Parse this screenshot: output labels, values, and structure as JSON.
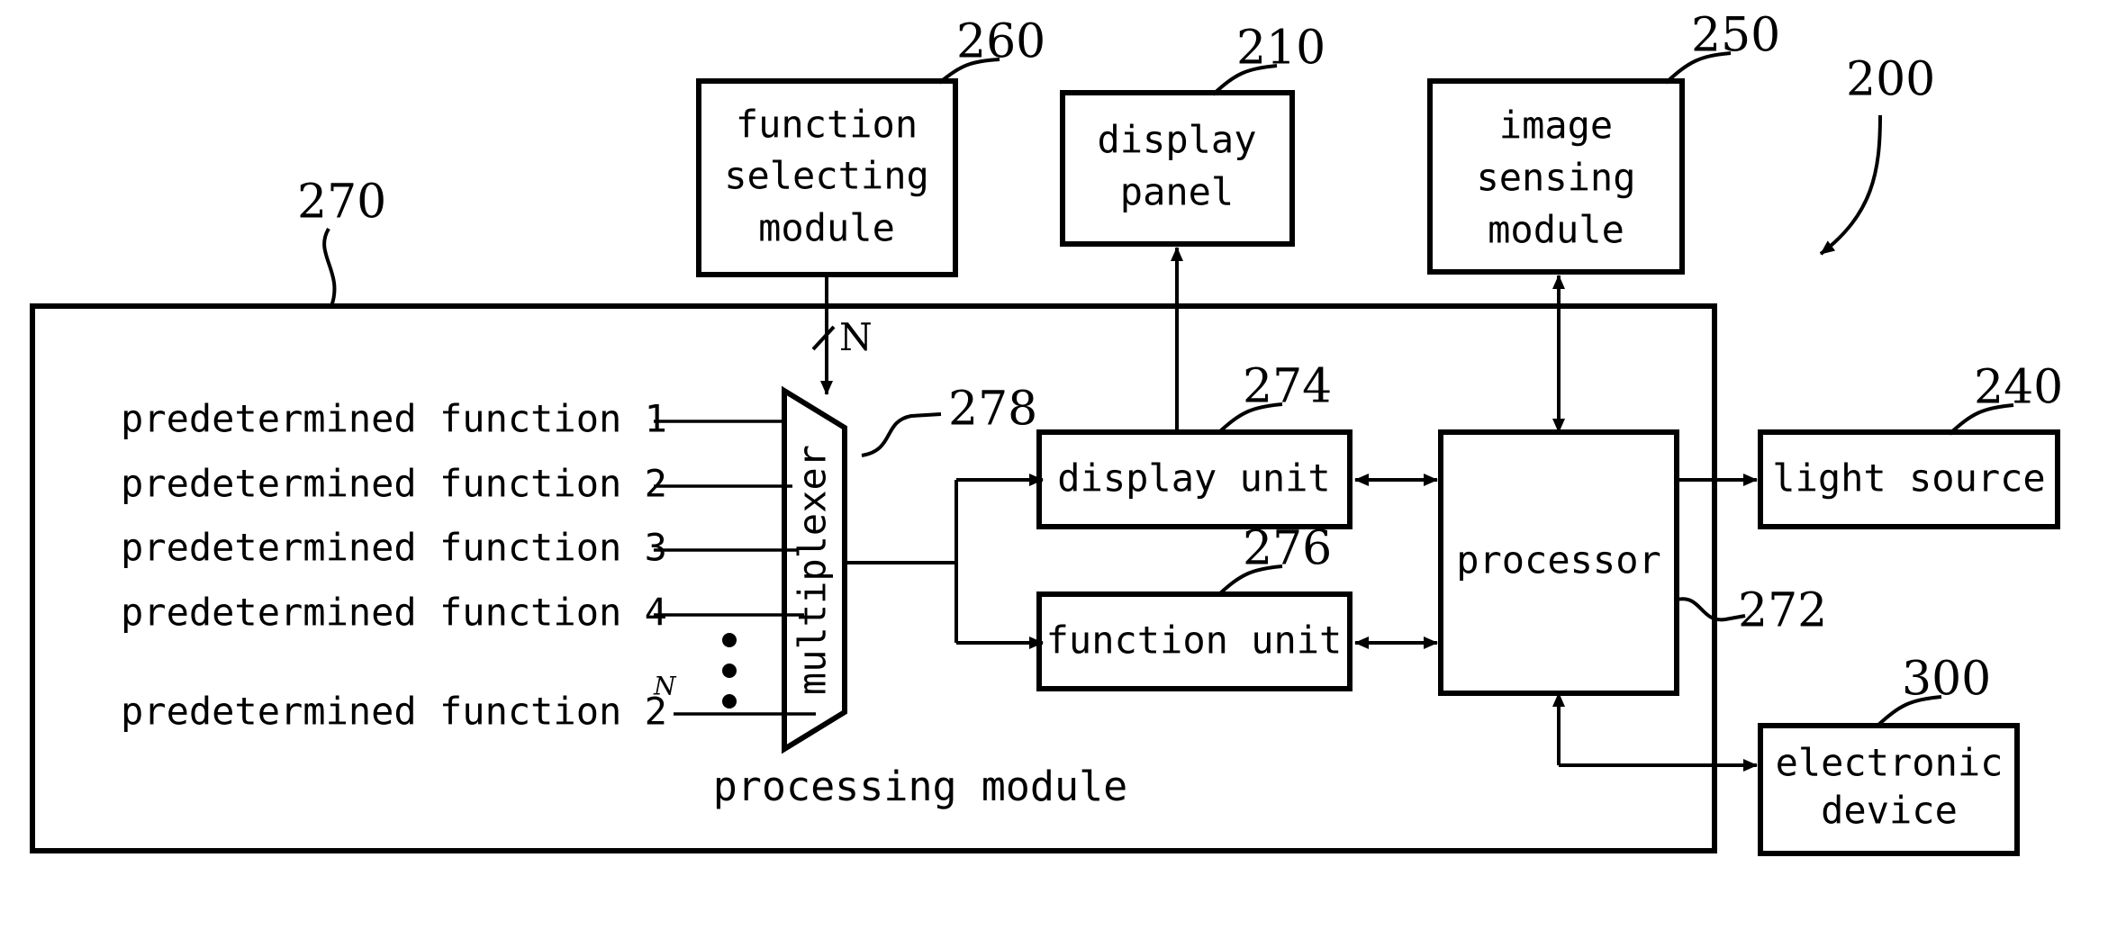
{
  "figure": {
    "title": "processing module block diagram",
    "overall_ref": "200",
    "processing_module_label": "processing module",
    "processing_module_ref": "270",
    "processor_bus_ref": "272",
    "bus_width_label": "N"
  },
  "blocks": {
    "function_selecting_module": {
      "lines": [
        "function",
        "selecting",
        "module"
      ],
      "ref": "260"
    },
    "display_panel": {
      "lines": [
        "display",
        "panel"
      ],
      "ref": "210"
    },
    "image_sensing_module": {
      "lines": [
        "image",
        "sensing",
        "module"
      ],
      "ref": "250"
    },
    "multiplexer": {
      "label": "multiplexer",
      "ref": "278"
    },
    "display_unit": {
      "label": "display unit",
      "ref": "274"
    },
    "function_unit": {
      "label": "function unit",
      "ref": "276"
    },
    "processor": {
      "label": "processor",
      "ref": ""
    },
    "light_source": {
      "label": "light source",
      "ref": "240"
    },
    "electronic_device": {
      "lines": [
        "electronic",
        "device"
      ],
      "ref": "300"
    }
  },
  "predetermined_functions": [
    {
      "label": "predetermined function 1",
      "sup": ""
    },
    {
      "label": "predetermined function 2",
      "sup": ""
    },
    {
      "label": "predetermined function 3",
      "sup": ""
    },
    {
      "label": "predetermined function 4",
      "sup": ""
    },
    {
      "label": "predetermined function 2",
      "sup": "N"
    }
  ],
  "colors": {
    "line": "#000000",
    "fill": "#ffffff",
    "text": "#000000"
  }
}
